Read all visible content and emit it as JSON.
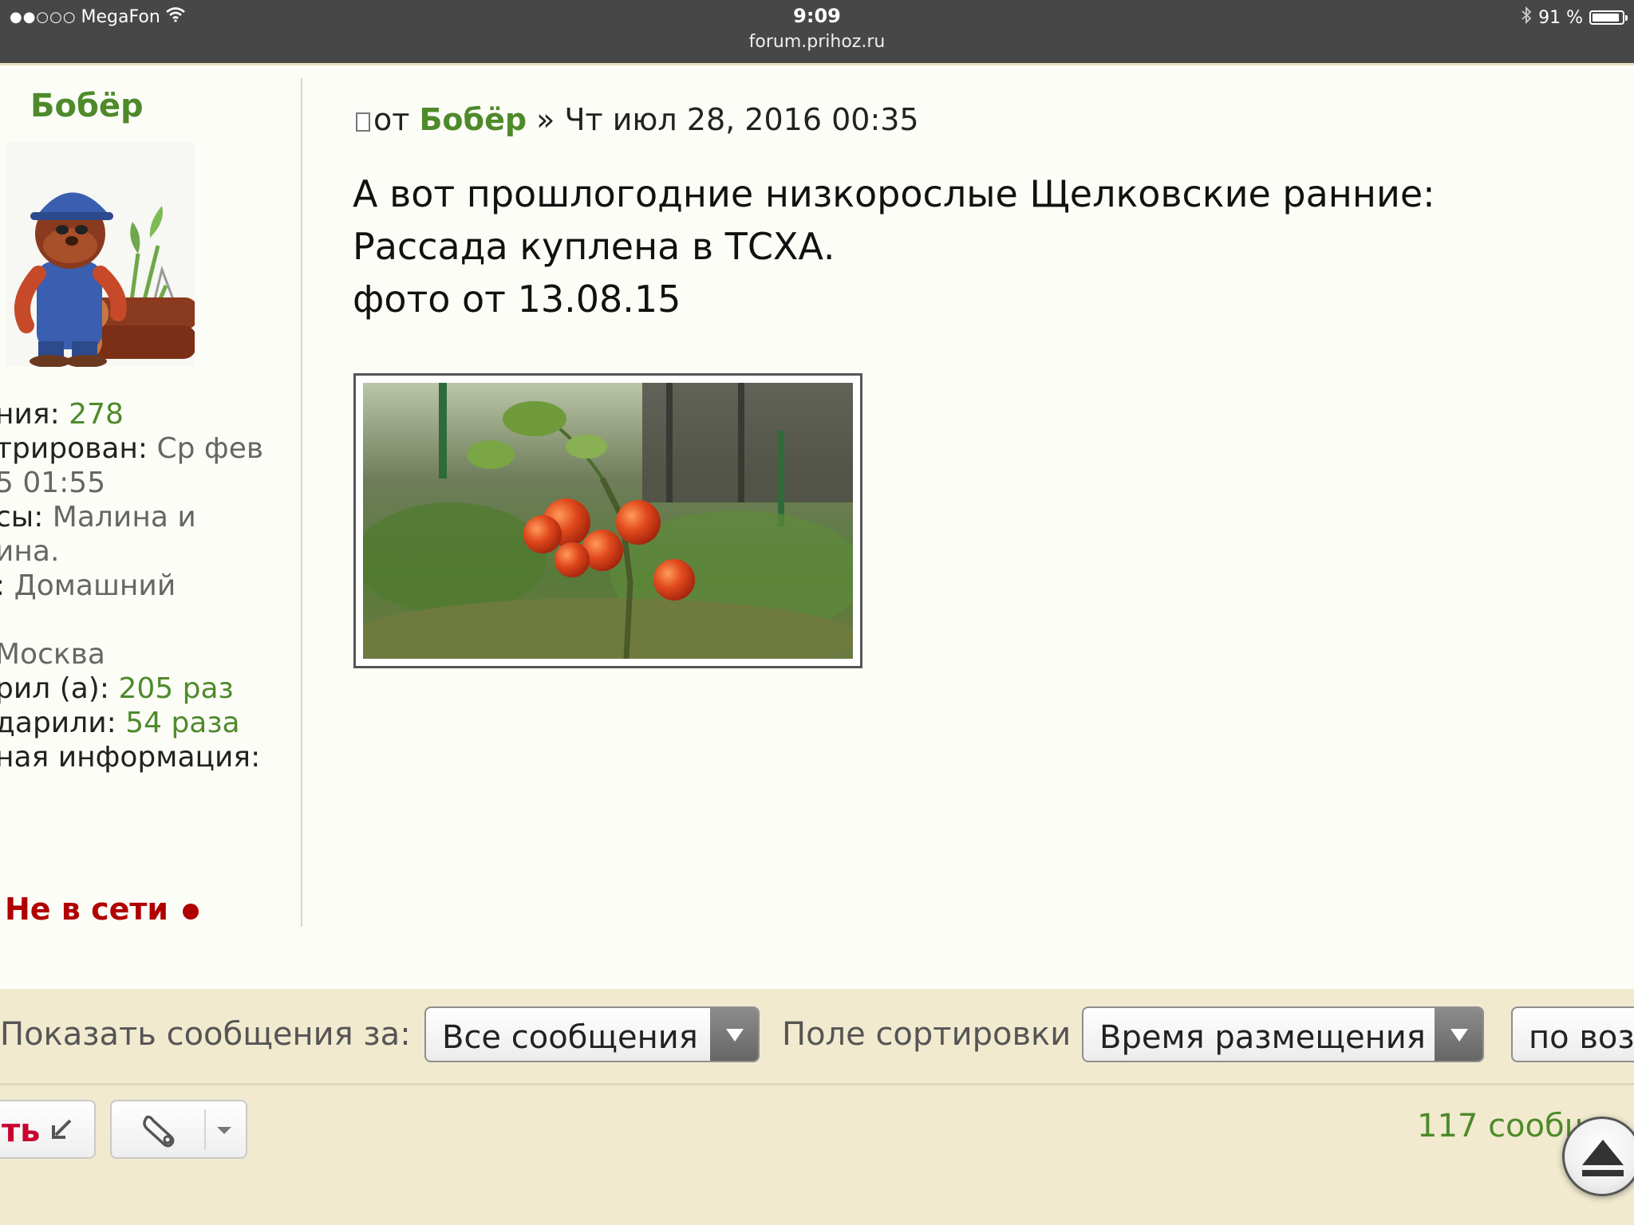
{
  "status_bar": {
    "signal": "●●○○○",
    "carrier": "MegaFon",
    "time": "9:09",
    "url": "forum.prihoz.ru",
    "battery_text": "91 %",
    "battery_level": 0.91
  },
  "profile": {
    "name": "Бобёр",
    "info_lines": [
      {
        "label": "ния: ",
        "value": "278",
        "value_color": "green"
      },
      {
        "label": "трирован: ",
        "value": "Ср фев",
        "value_color": "gray"
      },
      {
        "label": "",
        "value": "5 01:55",
        "value_color": "gray"
      },
      {
        "label": "сы: ",
        "value": "Малина и",
        "value_color": "gray"
      },
      {
        "label": "",
        "value": "ина.",
        "value_color": "gray"
      },
      {
        "label": ": ",
        "value": "Домашний",
        "value_color": "gray"
      },
      {
        "label": "",
        "value": "",
        "value_color": "gray"
      },
      {
        "label": "",
        "value": " Москва",
        "value_color": "gray"
      },
      {
        "label": "рил (а): ",
        "value": "205 раз",
        "value_color": "green"
      },
      {
        "label": "дарили: ",
        "value": "54 раза",
        "value_color": "green"
      },
      {
        "label": "ная информация:",
        "value": "",
        "value_color": "gray"
      }
    ],
    "status": "Не в сети"
  },
  "post": {
    "prefix": "от ",
    "author": "Бобёр",
    "separator": " » ",
    "date": "Чт июл 28, 2016 00:35",
    "body_lines": [
      "А вот прошлогодние низкорослые Щелковские ранние:",
      "Рассада куплена в ТСХА.",
      "фото от 13.08.15"
    ]
  },
  "sort_bar": {
    "show_label": "Показать сообщения за:",
    "show_value": "Все сообщения",
    "sort_label": "Поле сортировки",
    "sort_value": "Время размещения",
    "order_value": "по воз"
  },
  "action_bar": {
    "reply_label": "ть",
    "post_count": "117 сообщ"
  },
  "colors": {
    "accent_green": "#4e8a2a",
    "offline_red": "#b00000",
    "reply_red": "#c8002e",
    "bar_bg": "#f1eacf"
  },
  "icons": [
    "wifi-icon",
    "bluetooth-icon",
    "battery-icon",
    "post-icon",
    "reply-arrow-icon",
    "wrench-icon",
    "caret-down-icon",
    "scroll-top-icon"
  ]
}
